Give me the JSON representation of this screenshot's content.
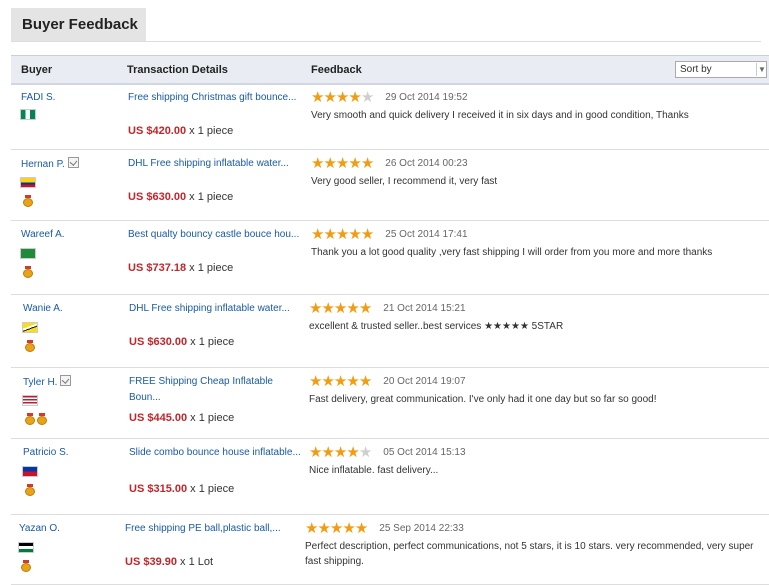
{
  "header": {
    "title": "Buyer Feedback"
  },
  "table": {
    "col_buyer": "Buyer",
    "col_transaction": "Transaction Details",
    "col_feedback": "Feedback",
    "sort_label": "Sort by"
  },
  "rows": [
    {
      "buyer": "FADI S.",
      "verified": false,
      "flag": "nigeria",
      "medals": 0,
      "transaction": "Free shipping Christmas gift bounce...",
      "price": "US $420.00",
      "qty": "x 1 piece",
      "rating": 4,
      "date": "29 Oct 2014 19:52",
      "feedback": "Very smooth and quick delivery I received it in six days and in good condition, Thanks"
    },
    {
      "buyer": "Hernan P.",
      "verified": true,
      "flag": "colombia",
      "medals": 1,
      "transaction": "DHL Free shipping inflatable water...",
      "price": "US $630.00",
      "qty": "x 1 piece",
      "rating": 5,
      "date": "26 Oct 2014 00:23",
      "feedback": "Very good seller, I recommend it, very fast"
    },
    {
      "buyer": "Wareef A.",
      "verified": false,
      "flag": "saudi",
      "medals": 1,
      "transaction": "Best qualty bouncy castle bouce hou...",
      "price": "US $737.18",
      "qty": "x 1 piece",
      "rating": 5,
      "date": "25 Oct 2014 17:41",
      "feedback": "Thank you a lot good quality ,very fast shipping I will order from you more and more thanks"
    },
    {
      "buyer": "Wanie A.",
      "verified": false,
      "flag": "brunei",
      "medals": 1,
      "transaction": "DHL Free shipping inflatable water...",
      "price": "US $630.00",
      "qty": "x 1 piece",
      "rating": 5,
      "date": "21 Oct 2014 15:21",
      "feedback": "excellent & trusted seller..best services ★★★★★ 5STAR"
    },
    {
      "buyer": "Tyler H.",
      "verified": true,
      "flag": "usa",
      "medals": 2,
      "transaction": "FREE Shipping Cheap Inflatable Boun...",
      "price": "US $445.00",
      "qty": "x 1 piece",
      "rating": 5,
      "date": "20 Oct 2014 19:07",
      "feedback": "Fast delivery, great communication. I've only had it one day but so far so good!"
    },
    {
      "buyer": "Patricio S.",
      "verified": false,
      "flag": "philippines",
      "medals": 1,
      "transaction": "Slide combo bounce house inflatable...",
      "price": "US $315.00",
      "qty": "x 1 piece",
      "rating": 4,
      "date": "05 Oct 2014 15:13",
      "feedback": "Nice inflatable. fast delivery..."
    },
    {
      "buyer": "Yazan O.",
      "verified": false,
      "flag": "jordan",
      "medals": 1,
      "transaction": "Free shipping PE ball,plastic ball,...",
      "price": "US $39.90",
      "qty": "x 1 Lot",
      "rating": 5,
      "date": "25 Sep 2014 22:33",
      "feedback": "Perfect description, perfect communications, not 5 stars, it is 10 stars. very recommended, very super fast shipping."
    }
  ],
  "colors": {
    "link": "#1a5aa6",
    "price": "#c1252a",
    "star": "#f39c12"
  }
}
